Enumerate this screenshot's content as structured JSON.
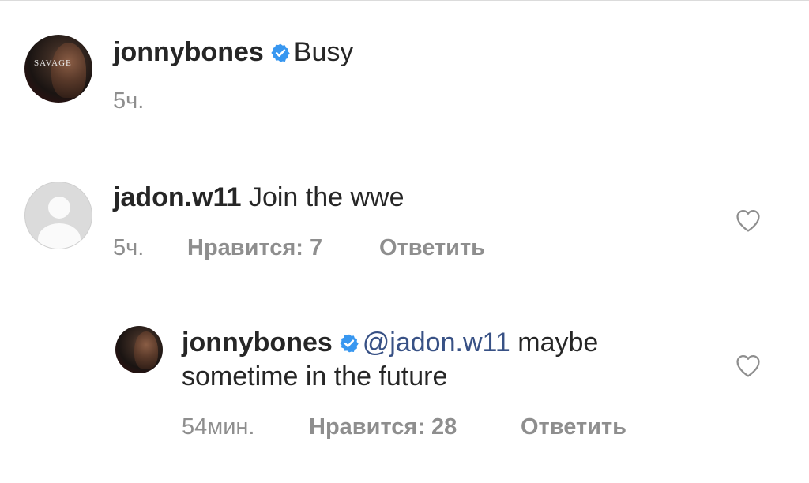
{
  "caption": {
    "username": "jonnybones",
    "verified": true,
    "text": "Busy",
    "time": "5ч.",
    "avatar_overlay_text": "SAVAGE"
  },
  "comments": [
    {
      "username": "jadon.w11",
      "verified": false,
      "text": "Join the wwe",
      "time": "5ч.",
      "likes_label": "Нравится: 7",
      "reply_label": "Ответить"
    },
    {
      "username": "jonnybones",
      "verified": true,
      "mention": "@jadon.w11",
      "text_line1": "maybe",
      "text_line2": "sometime in the future",
      "time": "54мин.",
      "likes_label": "Нравится: 28",
      "reply_label": "Ответить"
    }
  ],
  "icons": {
    "verified": "verified-badge-icon",
    "like": "heart-outline-icon"
  },
  "colors": {
    "text": "#262626",
    "secondary": "#8e8e8e",
    "mention": "#385185",
    "verified": "#3897f0",
    "divider": "#dbdbdb"
  }
}
